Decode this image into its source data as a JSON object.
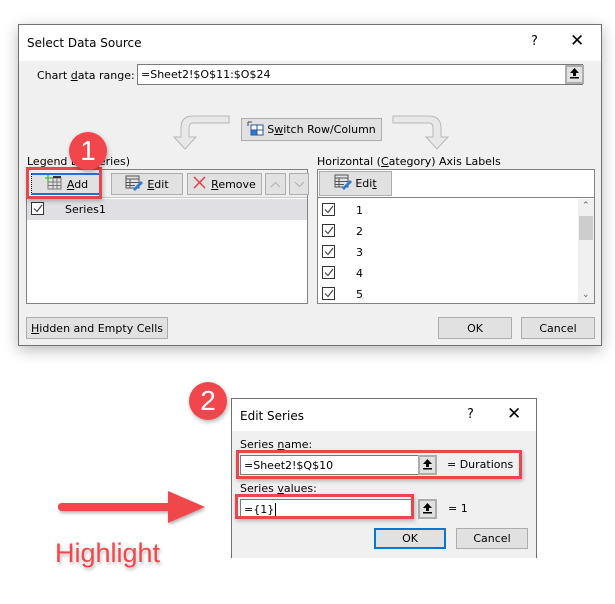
{
  "select_data_source": {
    "title": "Select Data Source",
    "help": "?",
    "close": "✕",
    "chart_range_label_pre": "Chart ",
    "chart_range_label_u": "d",
    "chart_range_label_post": "ata range:",
    "chart_range_value": "=Sheet2!$O$11:$O$24",
    "switch_pre": "S",
    "switch_u": "w",
    "switch_post": "itch Row/Column",
    "legend_label_pre": "Legend Entries (",
    "legend_label_u": "S",
    "legend_label_post": "eries)",
    "legend_label_visible": "Legend E",
    "legend_label_tail": "Series)",
    "add_u": "A",
    "add_post": "dd",
    "edit_u": "E",
    "edit_post": "dit",
    "remove_u": "R",
    "remove_post": "emove",
    "series": [
      {
        "name": "Series1",
        "checked": true,
        "selected": true
      }
    ],
    "axis_label_pre": "Horizontal (",
    "axis_label_u": "C",
    "axis_label_post": "ategory) Axis Labels",
    "axis_edit_pre": "Edi",
    "axis_edit_u": "t",
    "axis_items": [
      "1",
      "2",
      "3",
      "4",
      "5"
    ],
    "hidden_u": "H",
    "hidden_post": "idden and Empty Cells",
    "ok": "OK",
    "cancel": "Cancel"
  },
  "edit_series": {
    "title": "Edit Series",
    "help": "?",
    "close": "✕",
    "name_label_pre": "Series ",
    "name_label_u": "n",
    "name_label_post": "ame:",
    "name_value": "=Sheet2!$Q$10",
    "name_result": "= Durations",
    "values_label_pre": "Series ",
    "values_label_u": "v",
    "values_label_post": "alues:",
    "values_value": "={1}",
    "values_result": "= 1",
    "ok": "OK",
    "cancel": "Cancel"
  },
  "annotations": {
    "step1": "1",
    "step2": "2",
    "caption": "Highlight",
    "accent_color": "#f0464c"
  }
}
